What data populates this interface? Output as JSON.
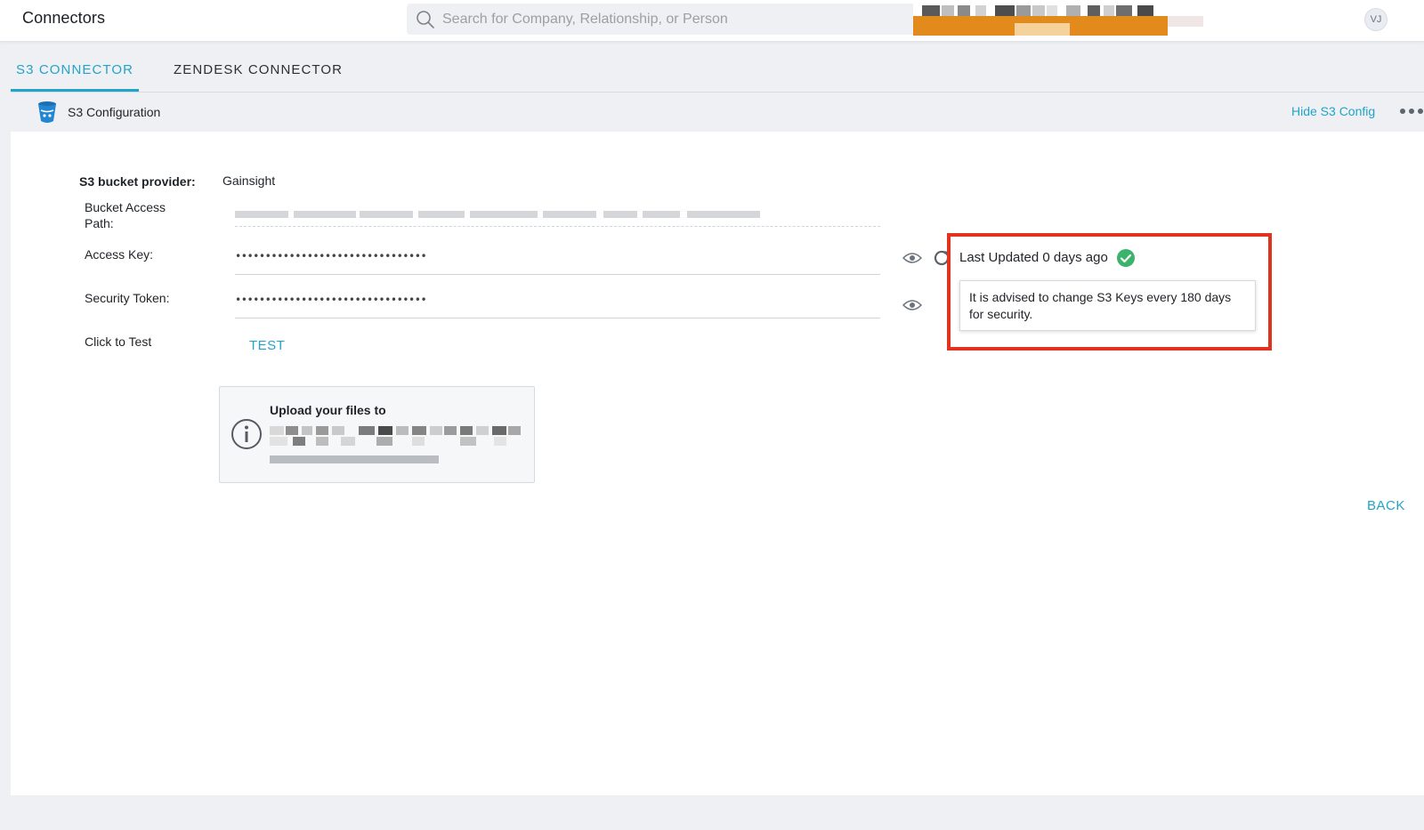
{
  "header": {
    "app_title": "Connectors",
    "search_placeholder": "Search for Company, Relationship, or Person",
    "avatar_initials": "VJ"
  },
  "tabs": [
    {
      "label": "S3 CONNECTOR",
      "active": true
    },
    {
      "label": "ZENDESK CONNECTOR",
      "active": false
    }
  ],
  "section": {
    "title": "S3 Configuration",
    "hide_link": "Hide S3 Config"
  },
  "form": {
    "provider_label": "S3 bucket provider:",
    "provider_value": "Gainsight",
    "bucket_path_label": "Bucket Access Path:",
    "access_key_label": "Access Key:",
    "access_key_value": "••••••••••••••••••••••••••••••••",
    "security_token_label": "Security Token:",
    "security_token_value": "••••••••••••••••••••••••••••••••",
    "test_label": "Click to Test",
    "test_button": "TEST"
  },
  "info": {
    "title": "Upload your files to"
  },
  "update": {
    "last_updated": "Last Updated 0 days ago",
    "advice": "It is advised to change S3 Keys every 180 days for security."
  },
  "actions": {
    "back": "BACK"
  },
  "colors": {
    "accent": "#21a4c9",
    "highlight_border": "#e0341f",
    "success": "#3bb36b",
    "banner": "#e38a1d"
  },
  "icons": [
    "search-icon",
    "bucket-icon",
    "more-icon",
    "eye-icon",
    "refresh-icon",
    "check-circle-icon",
    "info-icon"
  ]
}
